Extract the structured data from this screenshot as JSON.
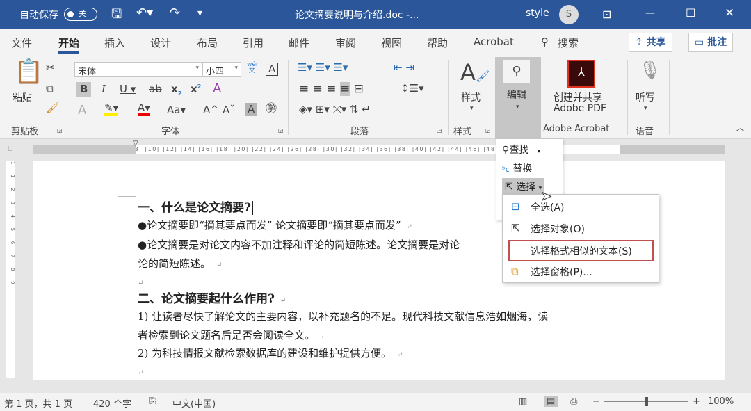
{
  "titlebar": {
    "autosave_label": "自动保存",
    "autosave_state": "关",
    "doc_title": "论文摘要说明与介绍.doc -...",
    "user": "style",
    "avatar_initial": "S"
  },
  "tabs": [
    "文件",
    "开始",
    "插入",
    "设计",
    "布局",
    "引用",
    "邮件",
    "审阅",
    "视图",
    "帮助",
    "Acrobat"
  ],
  "search_label": "搜索",
  "share_label": "共享",
  "comment_label": "批注",
  "ribbon": {
    "clipboard": {
      "paste": "粘贴",
      "group": "剪贴板"
    },
    "font": {
      "name": "宋体",
      "size": "小四",
      "phonetic": "wén\n文",
      "group": "字体",
      "change_case": "Aa"
    },
    "paragraph": {
      "group": "段落"
    },
    "styles": {
      "label": "样式",
      "group": "样式"
    },
    "editing": {
      "label": "编辑"
    },
    "acrobat": {
      "line1": "创建并共享",
      "line2": "Adobe PDF",
      "group": "Adobe Acrobat"
    },
    "voice": {
      "label": "听写",
      "group": "语音"
    }
  },
  "ruler": {
    "text": "|8| |6| |4| |2| | |2| |4| |6| |8| |10| |12| |14| |16| |18| |20| |22| |24| |26| |28| |30| |32| |34| |36| |38| |40| |42| |44| |46| |48"
  },
  "document": {
    "lines": [
      "一、什么是论文摘要?",
      "●论文摘要即“摘其要点而发” 论文摘要即“摘其要点而发”",
      "●论文摘要是对论文内容不加注释和评论的简短陈述。论文摘要是对论",
      "论的简短陈述。",
      "二、论文摘要起什么作用?",
      "1) 让读者尽快了解论文的主要内容，以补充题名的不足。现代科技文献信息浩如烟海，读",
      "者检索到论文题名后是否会阅读全文。",
      "2) 为科技情报文献检索数据库的建设和维护提供方便。"
    ]
  },
  "edit_menu": {
    "find": "查找",
    "replace": "替换",
    "select": "选择"
  },
  "select_menu": [
    "全选(A)",
    "选择对象(O)",
    "选择格式相似的文本(S)",
    "选择窗格(P)..."
  ],
  "status": {
    "page": "第 1 页，共 1 页",
    "words": "420 个字",
    "language": "中文(中国)",
    "zoom": "100%"
  }
}
